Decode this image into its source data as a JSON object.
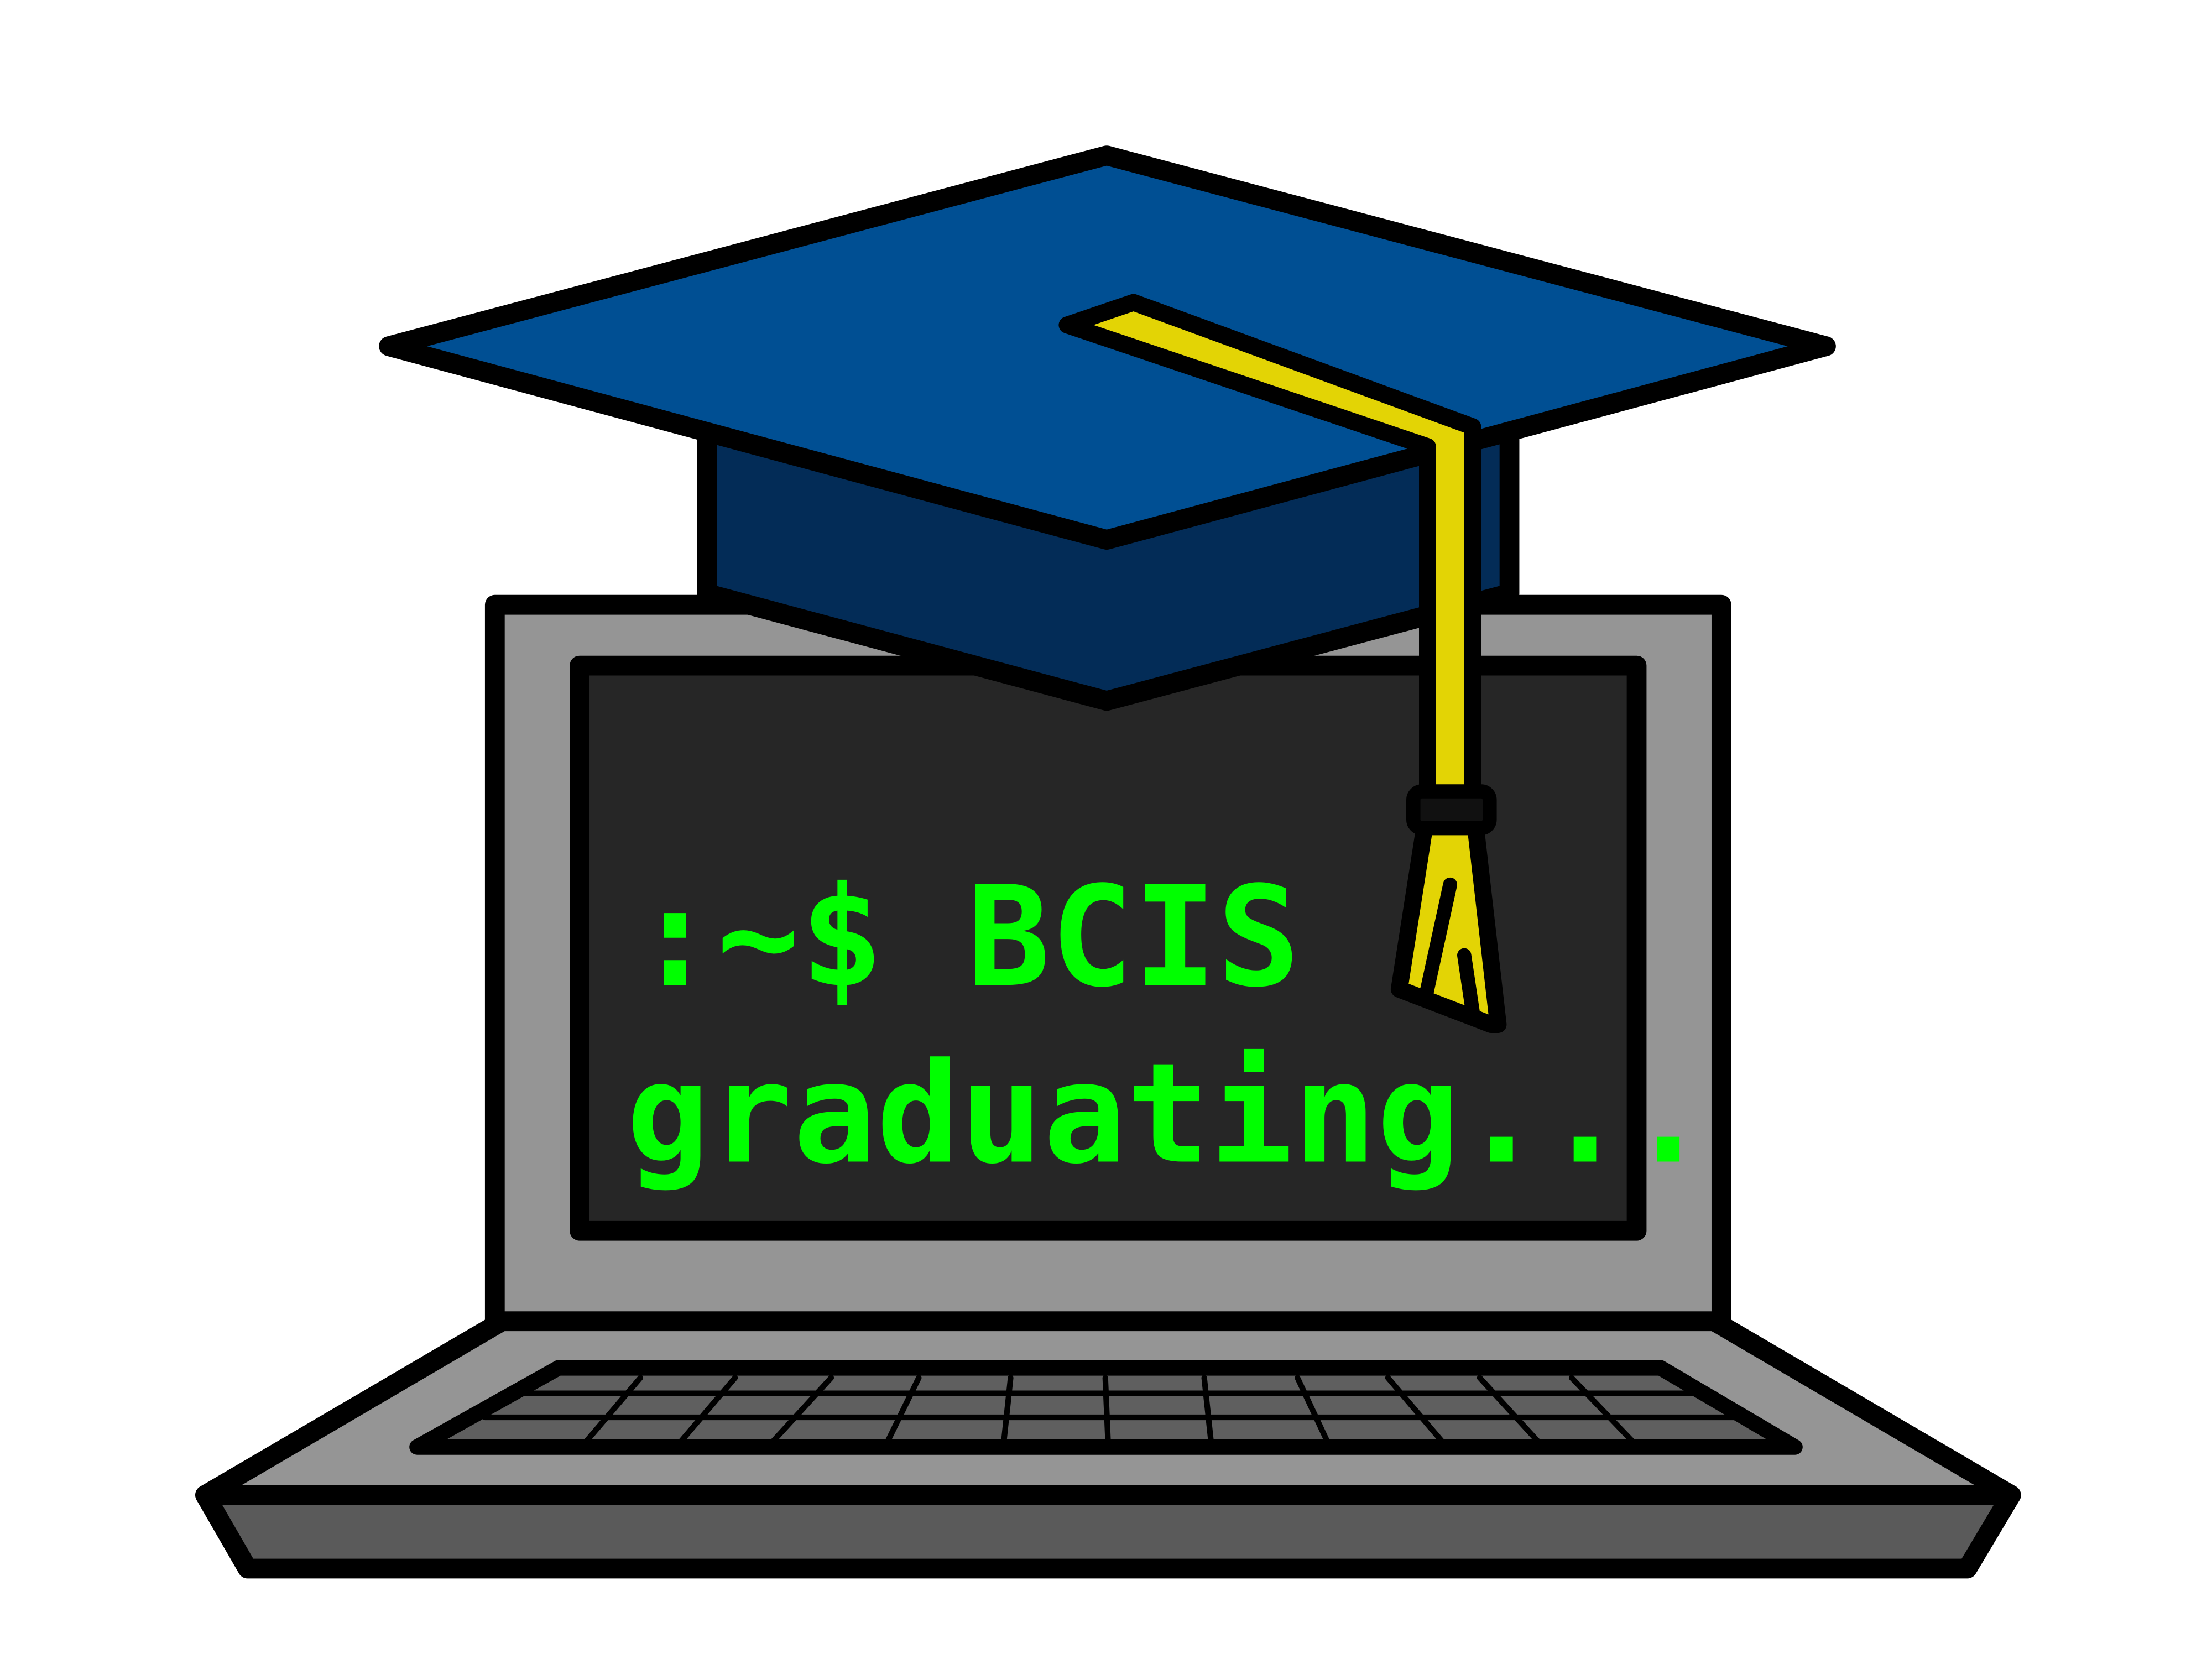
{
  "terminal": {
    "line1": ":~$ BCIS",
    "line2": "graduating..."
  },
  "colors": {
    "background": "#ffffff",
    "outline": "#000000",
    "laptop_body": "#959595",
    "laptop_base_front": "#5a5a5a",
    "keyboard": "#5f5f5f",
    "screen": "#262626",
    "terminal_text": "#00ff00",
    "cap_top": "#004f93",
    "cap_band": "#032c57",
    "tassel": "#e3d405"
  },
  "icons": {
    "cap": "graduation-cap-icon",
    "laptop": "laptop-icon",
    "tassel": "tassel-icon"
  }
}
